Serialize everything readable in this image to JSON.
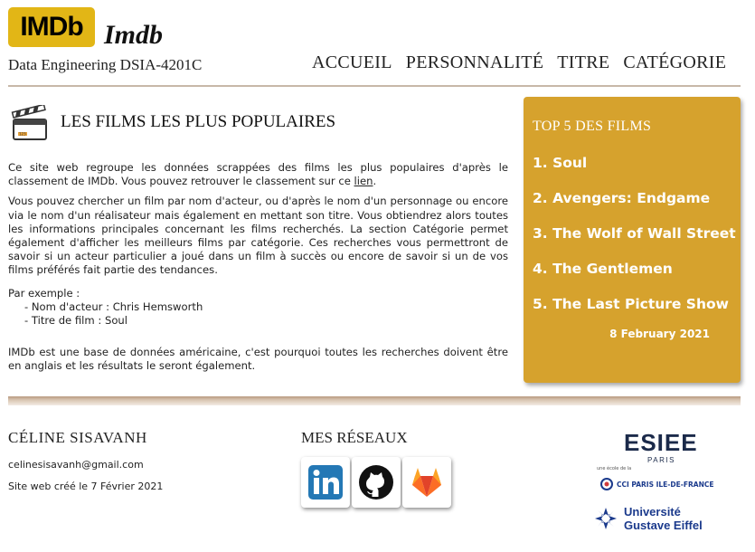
{
  "header": {
    "logo_text": "IMDb",
    "site_title": "Imdb",
    "subtitle": "Data Engineering DSIA-4201C",
    "nav": [
      "ACCUEIL",
      "PERSONNALITÉ",
      "TITRE",
      "CATÉGORIE"
    ]
  },
  "main": {
    "icon": "clapperboard-icon",
    "title": "LES FILMS LES PLUS POPULAIRES",
    "intro_before_link": "Ce site web regroupe les données scrappées des films les plus populaires d'après le classement de IMDb. Vous pouvez retrouver le classement sur ce ",
    "intro_link": "lien",
    "intro_after_link": ".",
    "paragraph2": "Vous pouvez chercher un film par nom d'acteur, ou d'après le nom d'un personnage ou encore via le nom d'un réalisateur mais également en mettant son titre. Vous obtiendrez alors toutes les informations principales concernant les films recherchés. La section Catégorie permet également d'afficher les meilleurs films par catégorie. Ces recherches vous permettront de savoir si un acteur particulier a joué dans un film à succès ou encore de savoir si un de vos films préférés fait partie des tendances.",
    "example_label": "Par exemple :",
    "example_items": [
      "- Nom d'acteur : Chris Hemsworth",
      "- Titre de film : Soul"
    ],
    "note": "IMDb est une base de données américaine, c'est pourquoi toutes les recherches doivent être en anglais et les résultats le seront également."
  },
  "top5": {
    "title": "TOP 5 DES FILMS",
    "items": [
      "1. Soul",
      "2. Avengers: Endgame",
      "3. The Wolf of Wall Street",
      "4. The Gentlemen",
      "5. The Last Picture Show"
    ],
    "date": "8 February 2021",
    "bg_color": "#d6a22d"
  },
  "footer": {
    "name": "CÉLINE SISAVANH",
    "email": "celinesisavanh@gmail.com",
    "created": "Site web créé le 7 Février 2021",
    "networks_title": "MES RÉSEAUX",
    "networks": [
      "linkedin-icon",
      "github-icon",
      "gitlab-icon"
    ],
    "esiee": "ESIEE",
    "esiee_city": "PARIS",
    "esiee_sub": "une école de la",
    "cci": "CCI PARIS ILE-DE-FRANCE",
    "university_line1": "Université",
    "university_line2": "Gustave Eiffel"
  }
}
